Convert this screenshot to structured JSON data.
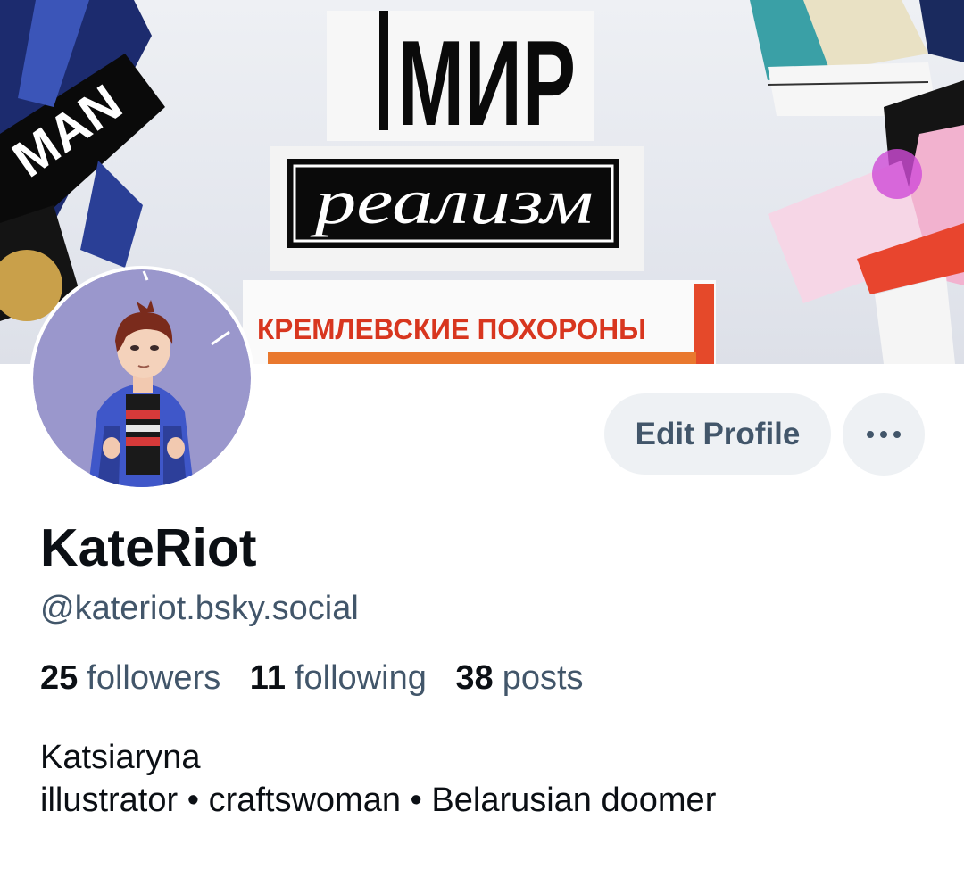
{
  "banner": {
    "title_word": "МИР",
    "subtitle_word": "реализм",
    "strip_text": "КРЕМЛЕВСКИЕ ПОХОРОНЫ",
    "left_strip_text": "MAN"
  },
  "actions": {
    "edit_profile_label": "Edit Profile",
    "more_icon": "ellipsis-icon"
  },
  "profile": {
    "display_name": "KateRiot",
    "handle": "@kateriot.bsky.social",
    "stats": {
      "followers_count": "25",
      "followers_label": "followers",
      "following_count": "11",
      "following_label": "following",
      "posts_count": "38",
      "posts_label": "posts"
    },
    "bio_line_1": "Katsiaryna",
    "bio_line_2": "illustrator • craftswoman • Belarusian doomer"
  },
  "colors": {
    "accent_text": "#42566a",
    "primary_text": "#0b0f14",
    "button_bg": "#eef1f4"
  }
}
